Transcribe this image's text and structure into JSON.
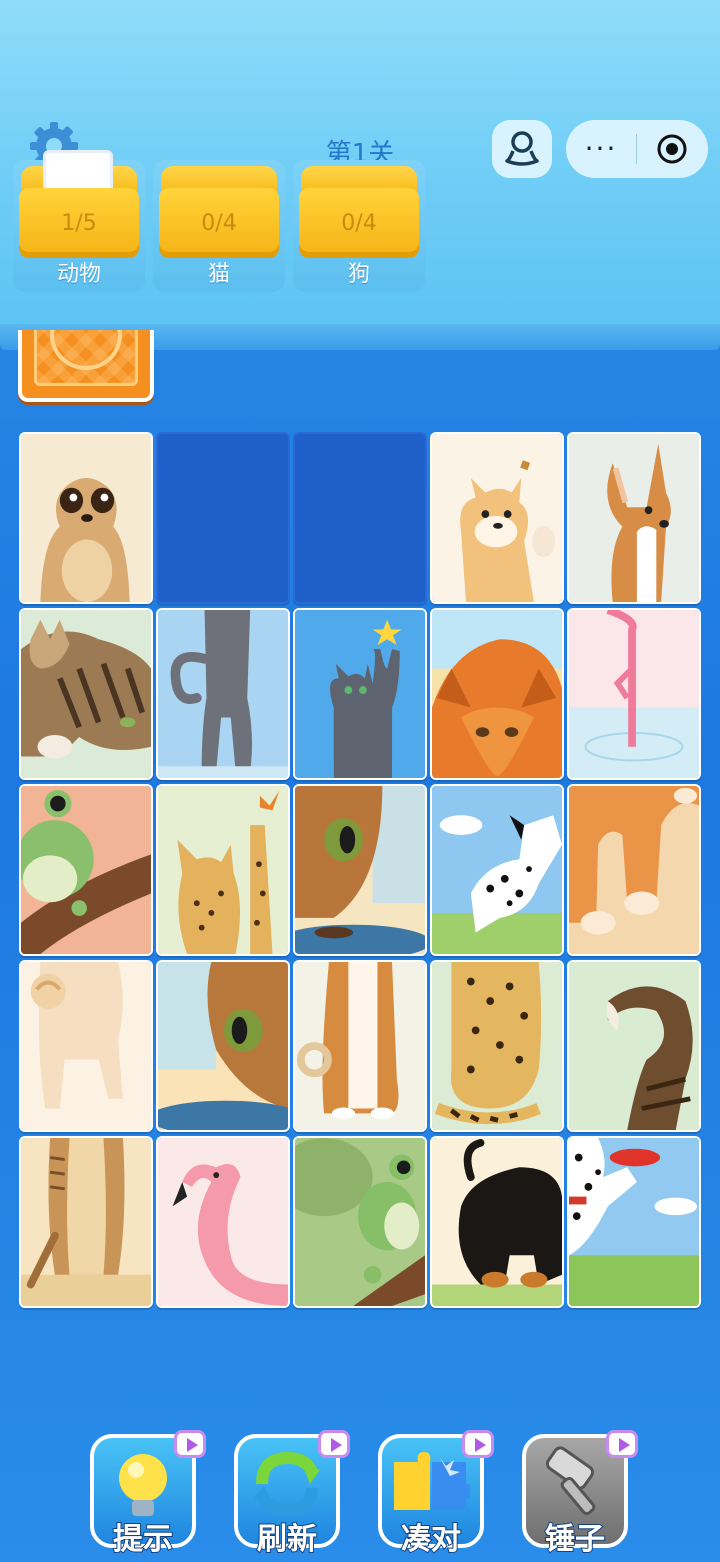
{
  "header": {
    "level": "第1关",
    "folders": [
      {
        "progress": "1/5",
        "name": "动物"
      },
      {
        "progress": "0/4",
        "name": "猫"
      },
      {
        "progress": "0/4",
        "name": "狗"
      }
    ],
    "more_label": "···"
  },
  "grid": {
    "rows": 5,
    "columns": 5,
    "cells": [
      "meerkat-face",
      "empty",
      "empty",
      "shiba-puppy",
      "basenji-dog",
      "tabby-cat-stretch",
      "gray-cat-legs",
      "gray-cat-star",
      "caracal-cat",
      "flamingo-legs",
      "frog-on-branch",
      "serval-butterfly",
      "cat-eye-bowl",
      "dalmatian-running",
      "orange-cat-paws",
      "shiba-tail",
      "cat-eye-bowl-2",
      "basenji-sitting",
      "cheetah-sitting",
      "fluffy-tail",
      "meerkat-body",
      "flamingo-head",
      "frog-branch-2",
      "rottweiler-play",
      "dalmatian-frisbee"
    ]
  },
  "tools": [
    {
      "label": "提示",
      "icon": "lightbulb-icon",
      "color": "#2fa6f0"
    },
    {
      "label": "刷新",
      "icon": "refresh-icon",
      "color": "#2fa6f0"
    },
    {
      "label": "凑对",
      "icon": "puzzle-icon",
      "color": "#2fa6f0"
    },
    {
      "label": "锤子",
      "icon": "hammer-icon",
      "color": "#8c8c8c"
    }
  ],
  "colors": {
    "header_bg": "#6fcdf6",
    "board_bg": "#1d78df",
    "folder_yellow": "#f5b214"
  }
}
